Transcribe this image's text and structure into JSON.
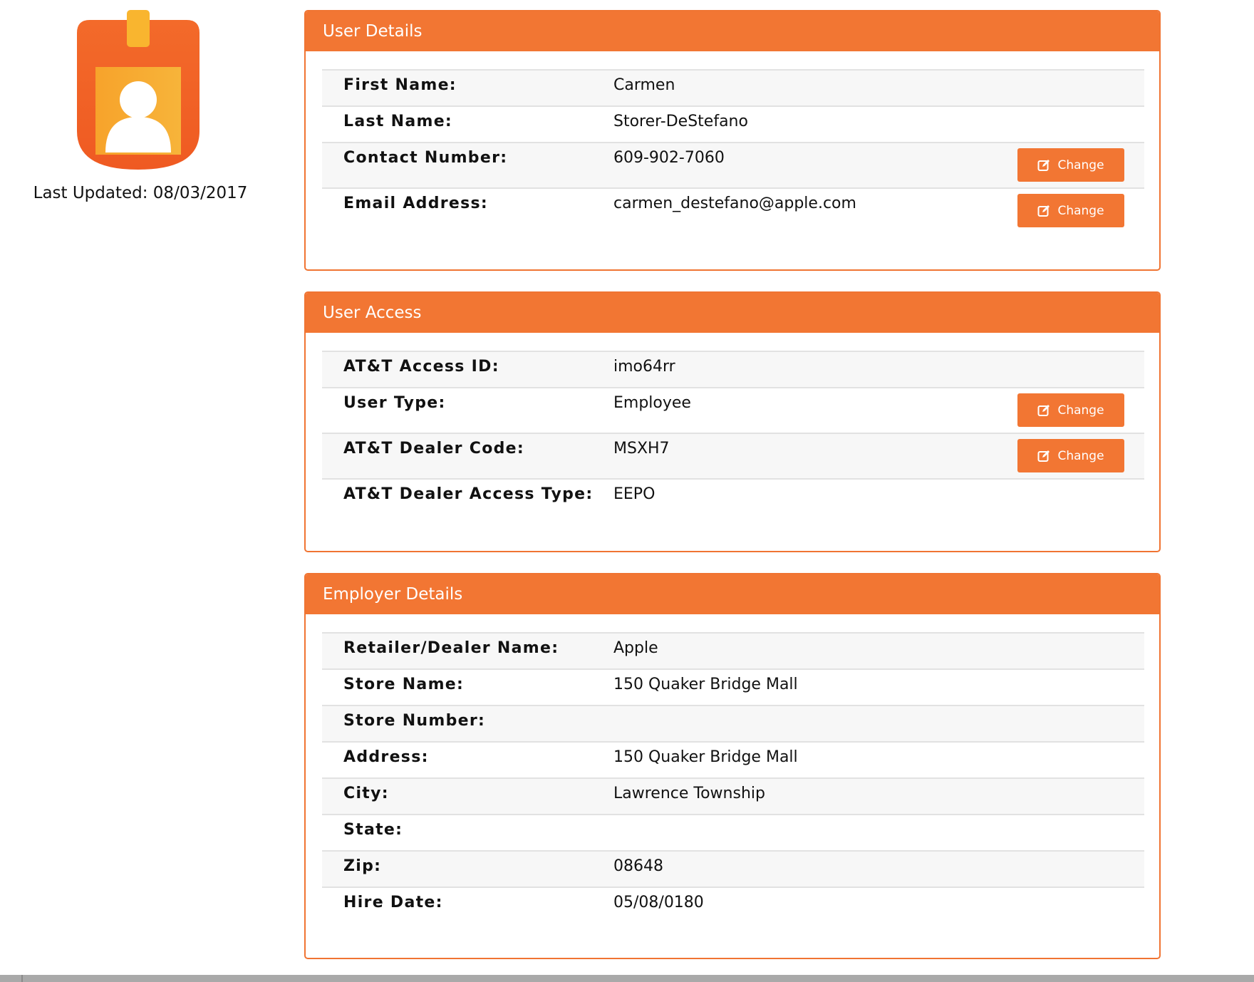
{
  "profile": {
    "last_updated": "Last Updated: 08/03/2017"
  },
  "change_label": "Change",
  "colors": {
    "accent": "#f27633",
    "row_shade": "#f7f7f7",
    "row_border": "#e2e2e2"
  },
  "user_details": {
    "title": "User Details",
    "rows": [
      {
        "label": "First Name:",
        "value": "Carmen"
      },
      {
        "label": "Last Name:",
        "value": "Storer-DeStefano"
      },
      {
        "label": "Contact Number:",
        "value": "609-902-7060"
      },
      {
        "label": "Email Address:",
        "value": "carmen_destefano@apple.com"
      }
    ]
  },
  "user_access": {
    "title": "User Access",
    "rows": [
      {
        "label": "AT&T Access ID:",
        "value": "imo64rr"
      },
      {
        "label": "User Type:",
        "value": "Employee"
      },
      {
        "label": "AT&T Dealer Code:",
        "value": "MSXH7"
      },
      {
        "label": "AT&T Dealer Access Type:",
        "value": "EEPO"
      }
    ]
  },
  "employer_details": {
    "title": "Employer Details",
    "rows": [
      {
        "label": "Retailer/Dealer Name:",
        "value": "Apple"
      },
      {
        "label": "Store Name:",
        "value": "150 Quaker Bridge Mall"
      },
      {
        "label": "Store Number:",
        "value": ""
      },
      {
        "label": "Address:",
        "value": "150 Quaker Bridge Mall"
      },
      {
        "label": "City:",
        "value": "Lawrence Township"
      },
      {
        "label": "State:",
        "value": ""
      },
      {
        "label": "Zip:",
        "value": "08648"
      },
      {
        "label": "Hire Date:",
        "value": "05/08/0180"
      }
    ]
  },
  "icons": {
    "avatar": "id-badge-icon",
    "change": "edit-icon"
  }
}
